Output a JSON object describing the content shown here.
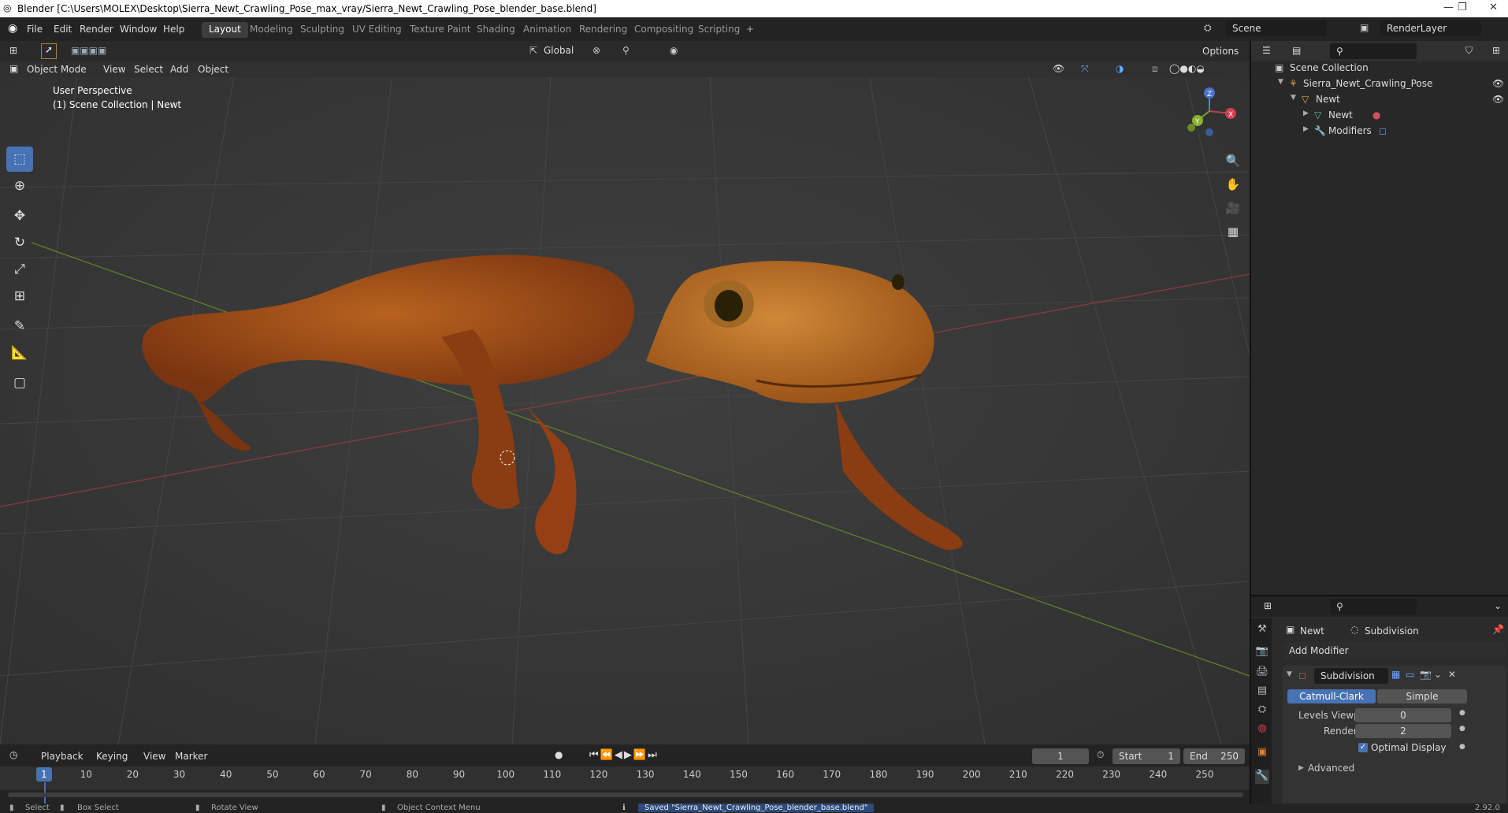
{
  "window": {
    "title": "Blender [C:\\Users\\MOLEX\\Desktop\\Sierra_Newt_Crawling_Pose_max_vray/Sierra_Newt_Crawling_Pose_blender_base.blend]",
    "min": "—",
    "max": "❐",
    "close": "✕"
  },
  "menubar": {
    "items": [
      "File",
      "Edit",
      "Render",
      "Window",
      "Help"
    ],
    "workspaces": [
      "Layout",
      "Modeling",
      "Sculpting",
      "UV Editing",
      "Texture Paint",
      "Shading",
      "Animation",
      "Rendering",
      "Compositing",
      "Scripting"
    ],
    "add_tab": "+",
    "scene": "Scene",
    "render_layer": "RenderLayer"
  },
  "viewport_header": {
    "transform_orientation": "Global",
    "options": "Options",
    "mode": "Object Mode",
    "menus": [
      "View",
      "Select",
      "Add",
      "Object"
    ]
  },
  "viewport": {
    "perspective": "User Perspective",
    "collection_info": "(1) Scene Collection | Newt",
    "gizmo": {
      "z": "Z",
      "x": "X",
      "y": "Y"
    }
  },
  "outliner": {
    "rows": [
      {
        "label": "Scene Collection",
        "icon": "collection-icon"
      },
      {
        "label": "Sierra_Newt_Crawling_Pose",
        "icon": "object-icon"
      },
      {
        "label": "Newt",
        "icon": "mesh-object-icon"
      },
      {
        "label": "Newt",
        "icon": "mesh-data-icon"
      },
      {
        "label": "Modifiers",
        "icon": "wrench-icon"
      }
    ]
  },
  "properties": {
    "object": "Newt",
    "modifier_name_header": "Subdivision",
    "add_modifier": "Add Modifier",
    "modifier": {
      "name": "Subdivision",
      "type_options": [
        "Catmull-Clark",
        "Simple"
      ],
      "selected_type": "Catmull-Clark",
      "levels_viewport_label": "Levels Viewport",
      "levels_viewport": "0",
      "render_label": "Render",
      "render": "2",
      "optimal_display_label": "Optimal Display",
      "optimal_display": true,
      "advanced": "Advanced"
    }
  },
  "timeline": {
    "menus": [
      "Playback",
      "Keying",
      "View",
      "Marker"
    ],
    "current_frame": "1",
    "start_label": "Start",
    "start": "1",
    "end_label": "End",
    "end": "250",
    "ticks": [
      "1",
      "10",
      "20",
      "30",
      "40",
      "50",
      "60",
      "70",
      "80",
      "90",
      "100",
      "110",
      "120",
      "130",
      "140",
      "150",
      "160",
      "170",
      "180",
      "190",
      "200",
      "210",
      "220",
      "230",
      "240",
      "250"
    ]
  },
  "statusbar": {
    "select": "Select",
    "box_select": "Box Select",
    "rotate_view": "Rotate View",
    "context_menu": "Object Context Menu",
    "message": "Saved \"Sierra_Newt_Crawling_Pose_blender_base.blend\"",
    "version": "2.92.0"
  },
  "colors": {
    "accent": "#4772b3",
    "newt_body": "#b0561e",
    "newt_head": "#c7782e",
    "axis_x": "#a04040",
    "axis_y": "#6a8a2a"
  }
}
